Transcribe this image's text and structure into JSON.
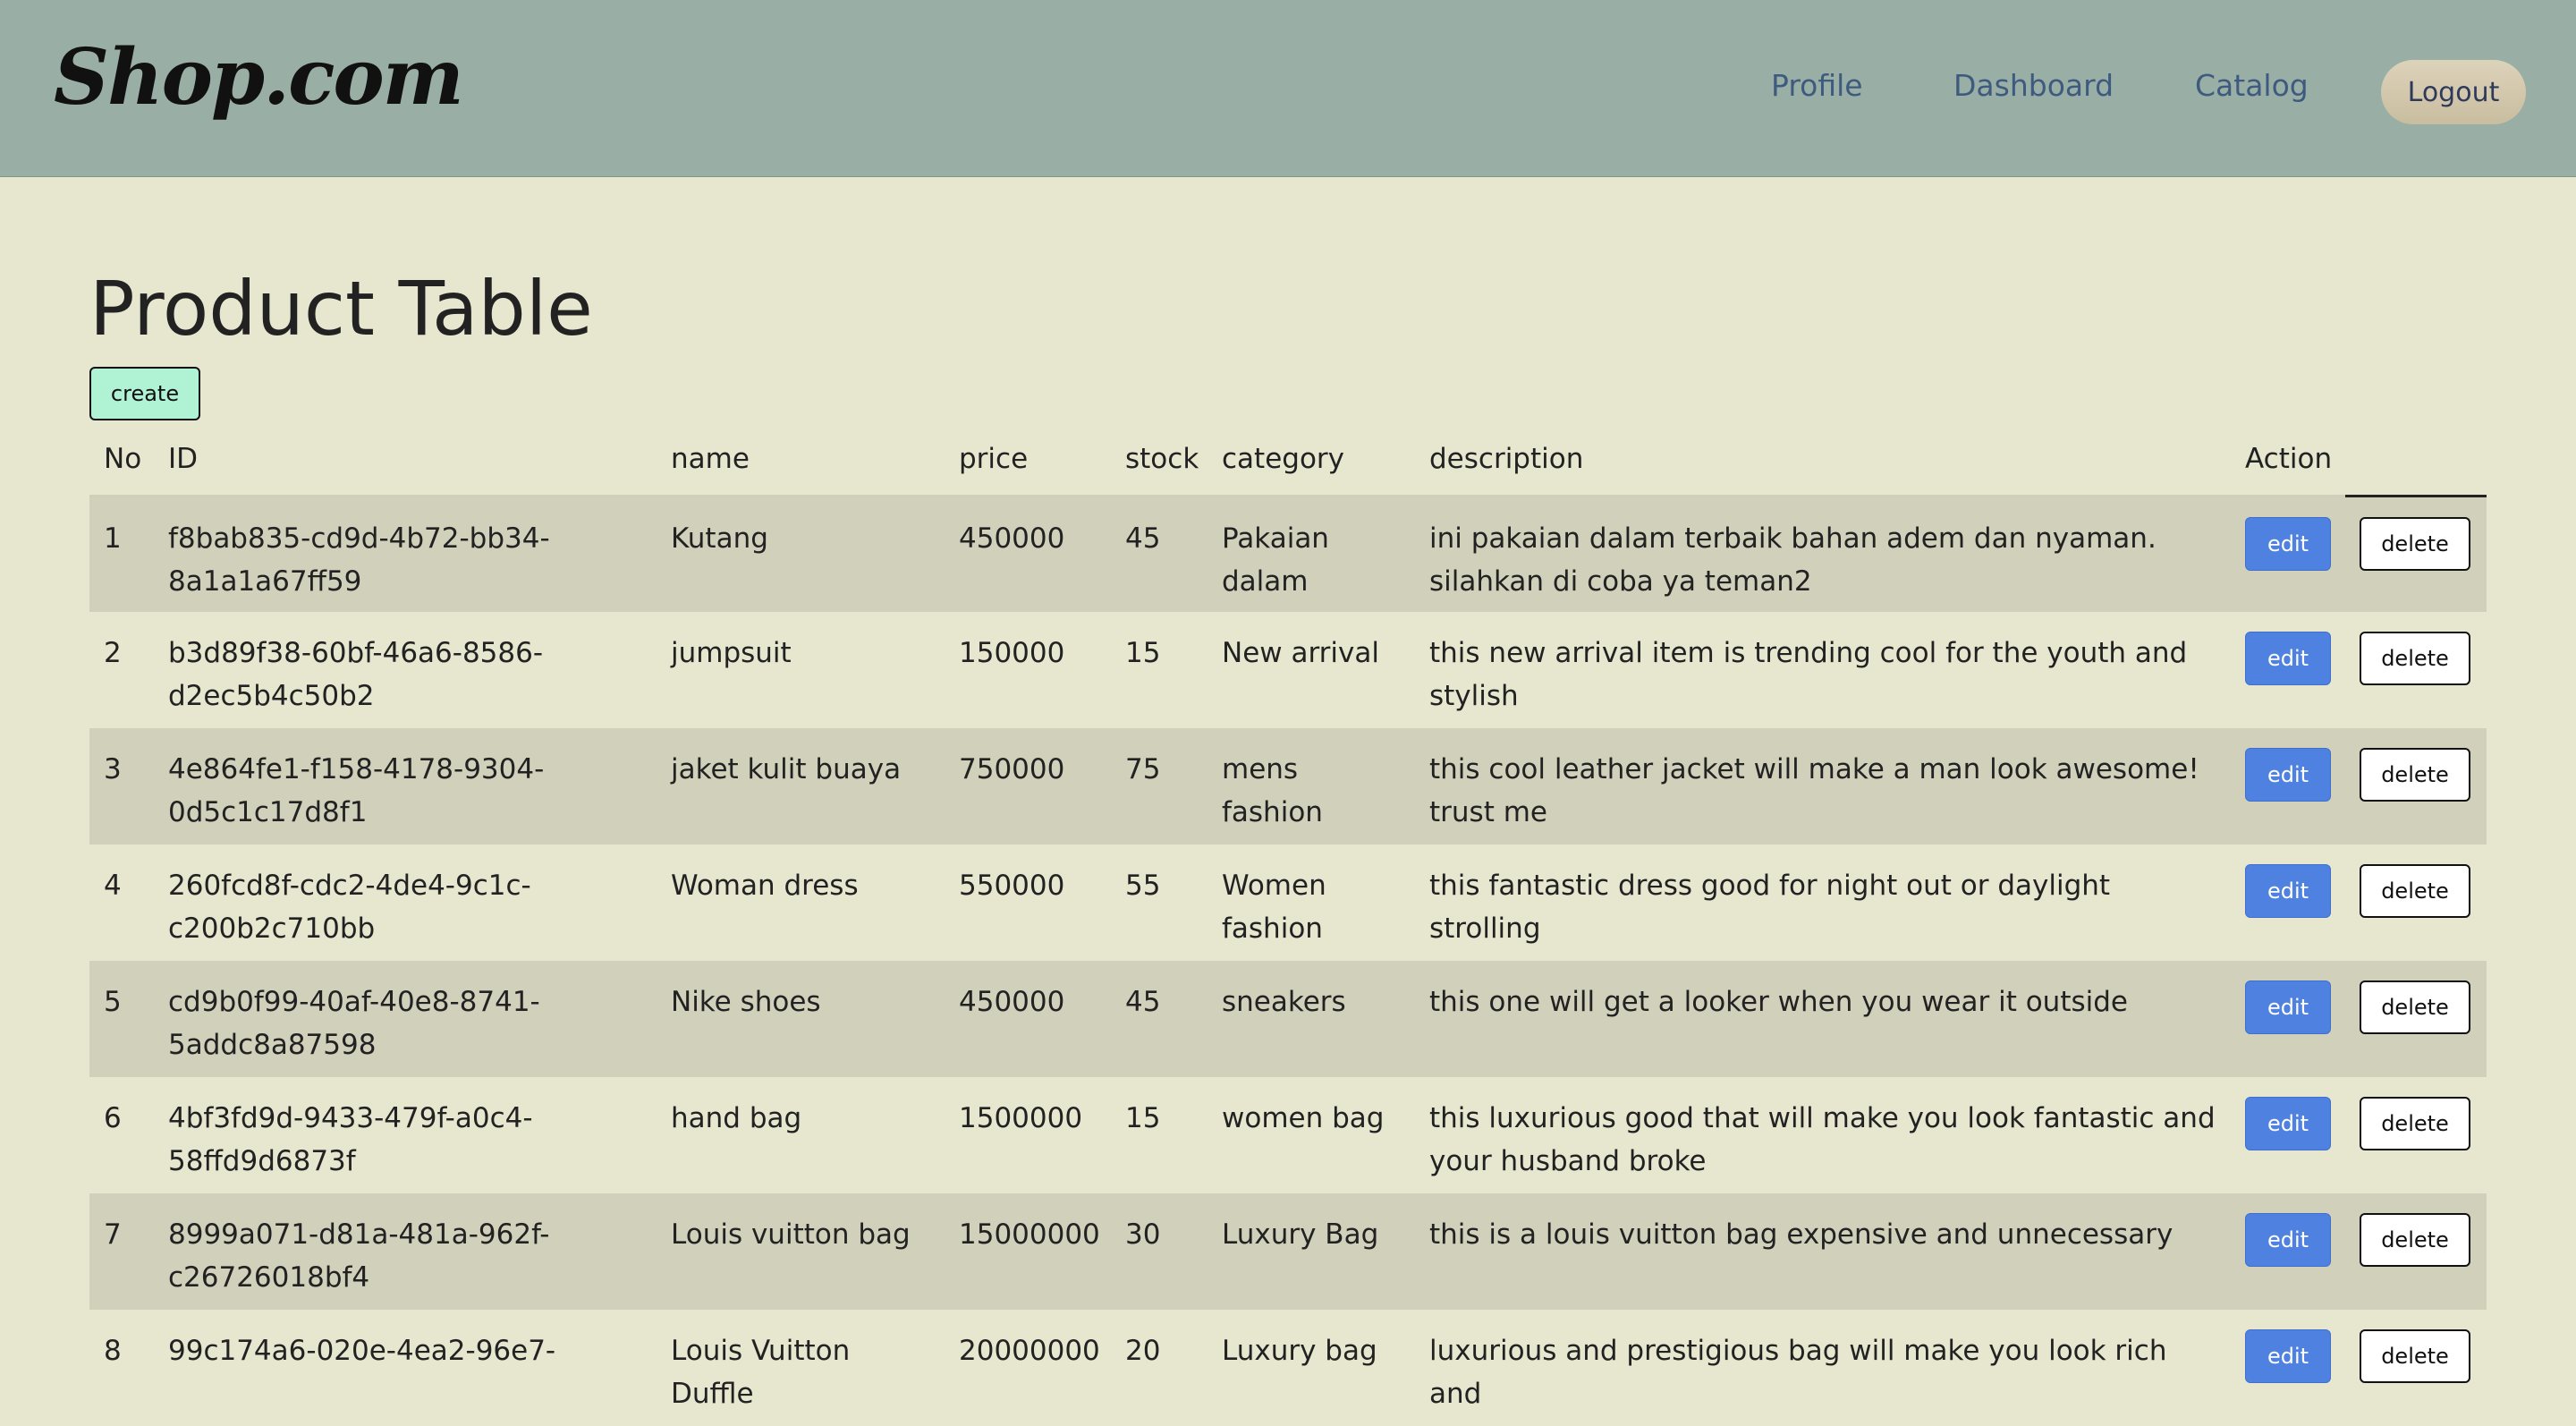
{
  "nav": {
    "brand": "Shop.com",
    "links": [
      "Profile",
      "Dashboard",
      "Catalog"
    ],
    "logout": "Logout"
  },
  "page": {
    "title": "Product Table",
    "create_label": "create"
  },
  "table": {
    "headers": [
      "No",
      "ID",
      "name",
      "price",
      "stock",
      "category",
      "description",
      "Action"
    ],
    "rows": [
      {
        "no": "1",
        "id": "f8bab835-cd9d-4b72-bb34-8a1a1a67ff59",
        "name": "Kutang",
        "price": "450000",
        "stock": "45",
        "category": "Pakaian dalam",
        "description": "ini pakaian dalam terbaik bahan adem dan nyaman. silahkan di coba ya teman2",
        "edit": "edit",
        "delete": "delete"
      },
      {
        "no": "2",
        "id": "b3d89f38-60bf-46a6-8586-d2ec5b4c50b2",
        "name": "jumpsuit",
        "price": "150000",
        "stock": "15",
        "category": "New arrival",
        "description": "this new arrival item is trending cool for the youth and stylish",
        "edit": "edit",
        "delete": "delete"
      },
      {
        "no": "3",
        "id": "4e864fe1-f158-4178-9304-0d5c1c17d8f1",
        "name": "jaket kulit buaya",
        "price": "750000",
        "stock": "75",
        "category": "mens fashion",
        "description": "this cool leather jacket will make a man look awesome! trust me",
        "edit": "edit",
        "delete": "delete"
      },
      {
        "no": "4",
        "id": "260fcd8f-cdc2-4de4-9c1c-c200b2c710bb",
        "name": "Woman dress",
        "price": "550000",
        "stock": "55",
        "category": "Women fashion",
        "description": "this fantastic dress good for night out or daylight strolling",
        "edit": "edit",
        "delete": "delete"
      },
      {
        "no": "5",
        "id": "cd9b0f99-40af-40e8-8741-5addc8a87598",
        "name": "Nike shoes",
        "price": "450000",
        "stock": "45",
        "category": "sneakers",
        "description": "this one will get a looker when you wear it outside",
        "edit": "edit",
        "delete": "delete"
      },
      {
        "no": "6",
        "id": "4bf3fd9d-9433-479f-a0c4-58ffd9d6873f",
        "name": "hand bag",
        "price": "1500000",
        "stock": "15",
        "category": "women bag",
        "description": "this luxurious good that will make you look fantastic and your husband broke",
        "edit": "edit",
        "delete": "delete"
      },
      {
        "no": "7",
        "id": "8999a071-d81a-481a-962f-c26726018bf4",
        "name": "Louis vuitton bag",
        "price": "15000000",
        "stock": "30",
        "category": "Luxury Bag",
        "description": "this is a louis vuitton bag expensive and unnecessary",
        "edit": "edit",
        "delete": "delete"
      },
      {
        "no": "8",
        "id": "99c174a6-020e-4ea2-96e7-",
        "name": "Louis Vuitton Duffle",
        "price": "20000000",
        "stock": "20",
        "category": "Luxury bag",
        "description": "luxurious and prestigious bag will make you look rich and",
        "edit": "edit",
        "delete": "delete"
      }
    ]
  }
}
